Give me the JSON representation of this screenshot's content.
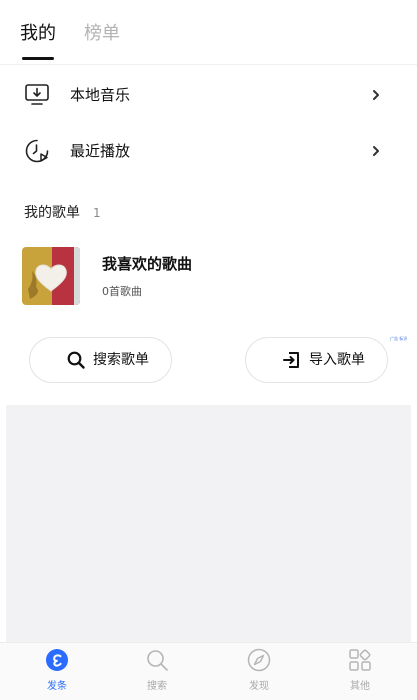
{
  "tabs": {
    "mine": "我的",
    "rank": "榜单"
  },
  "rows": {
    "local": "本地音乐",
    "recent": "最近播放"
  },
  "section": {
    "title": "我的歌单",
    "count": "1"
  },
  "playlist": {
    "title": "我喜欢的歌曲",
    "subtitle": "0首歌曲"
  },
  "ad_tag": "广告 标识",
  "buttons": {
    "search": "搜索歌单",
    "import": "导入歌单"
  },
  "tabbar": [
    {
      "label": "发条",
      "icon": "app-logo-icon",
      "active": true
    },
    {
      "label": "搜索",
      "icon": "search-icon",
      "active": false
    },
    {
      "label": "发现",
      "icon": "compass-icon",
      "active": false
    },
    {
      "label": "其他",
      "icon": "grid-icon",
      "active": false
    }
  ],
  "colors": {
    "accent": "#2b6cff",
    "inactive": "#a9a9a9",
    "background_gray": "#f2f2f4"
  }
}
